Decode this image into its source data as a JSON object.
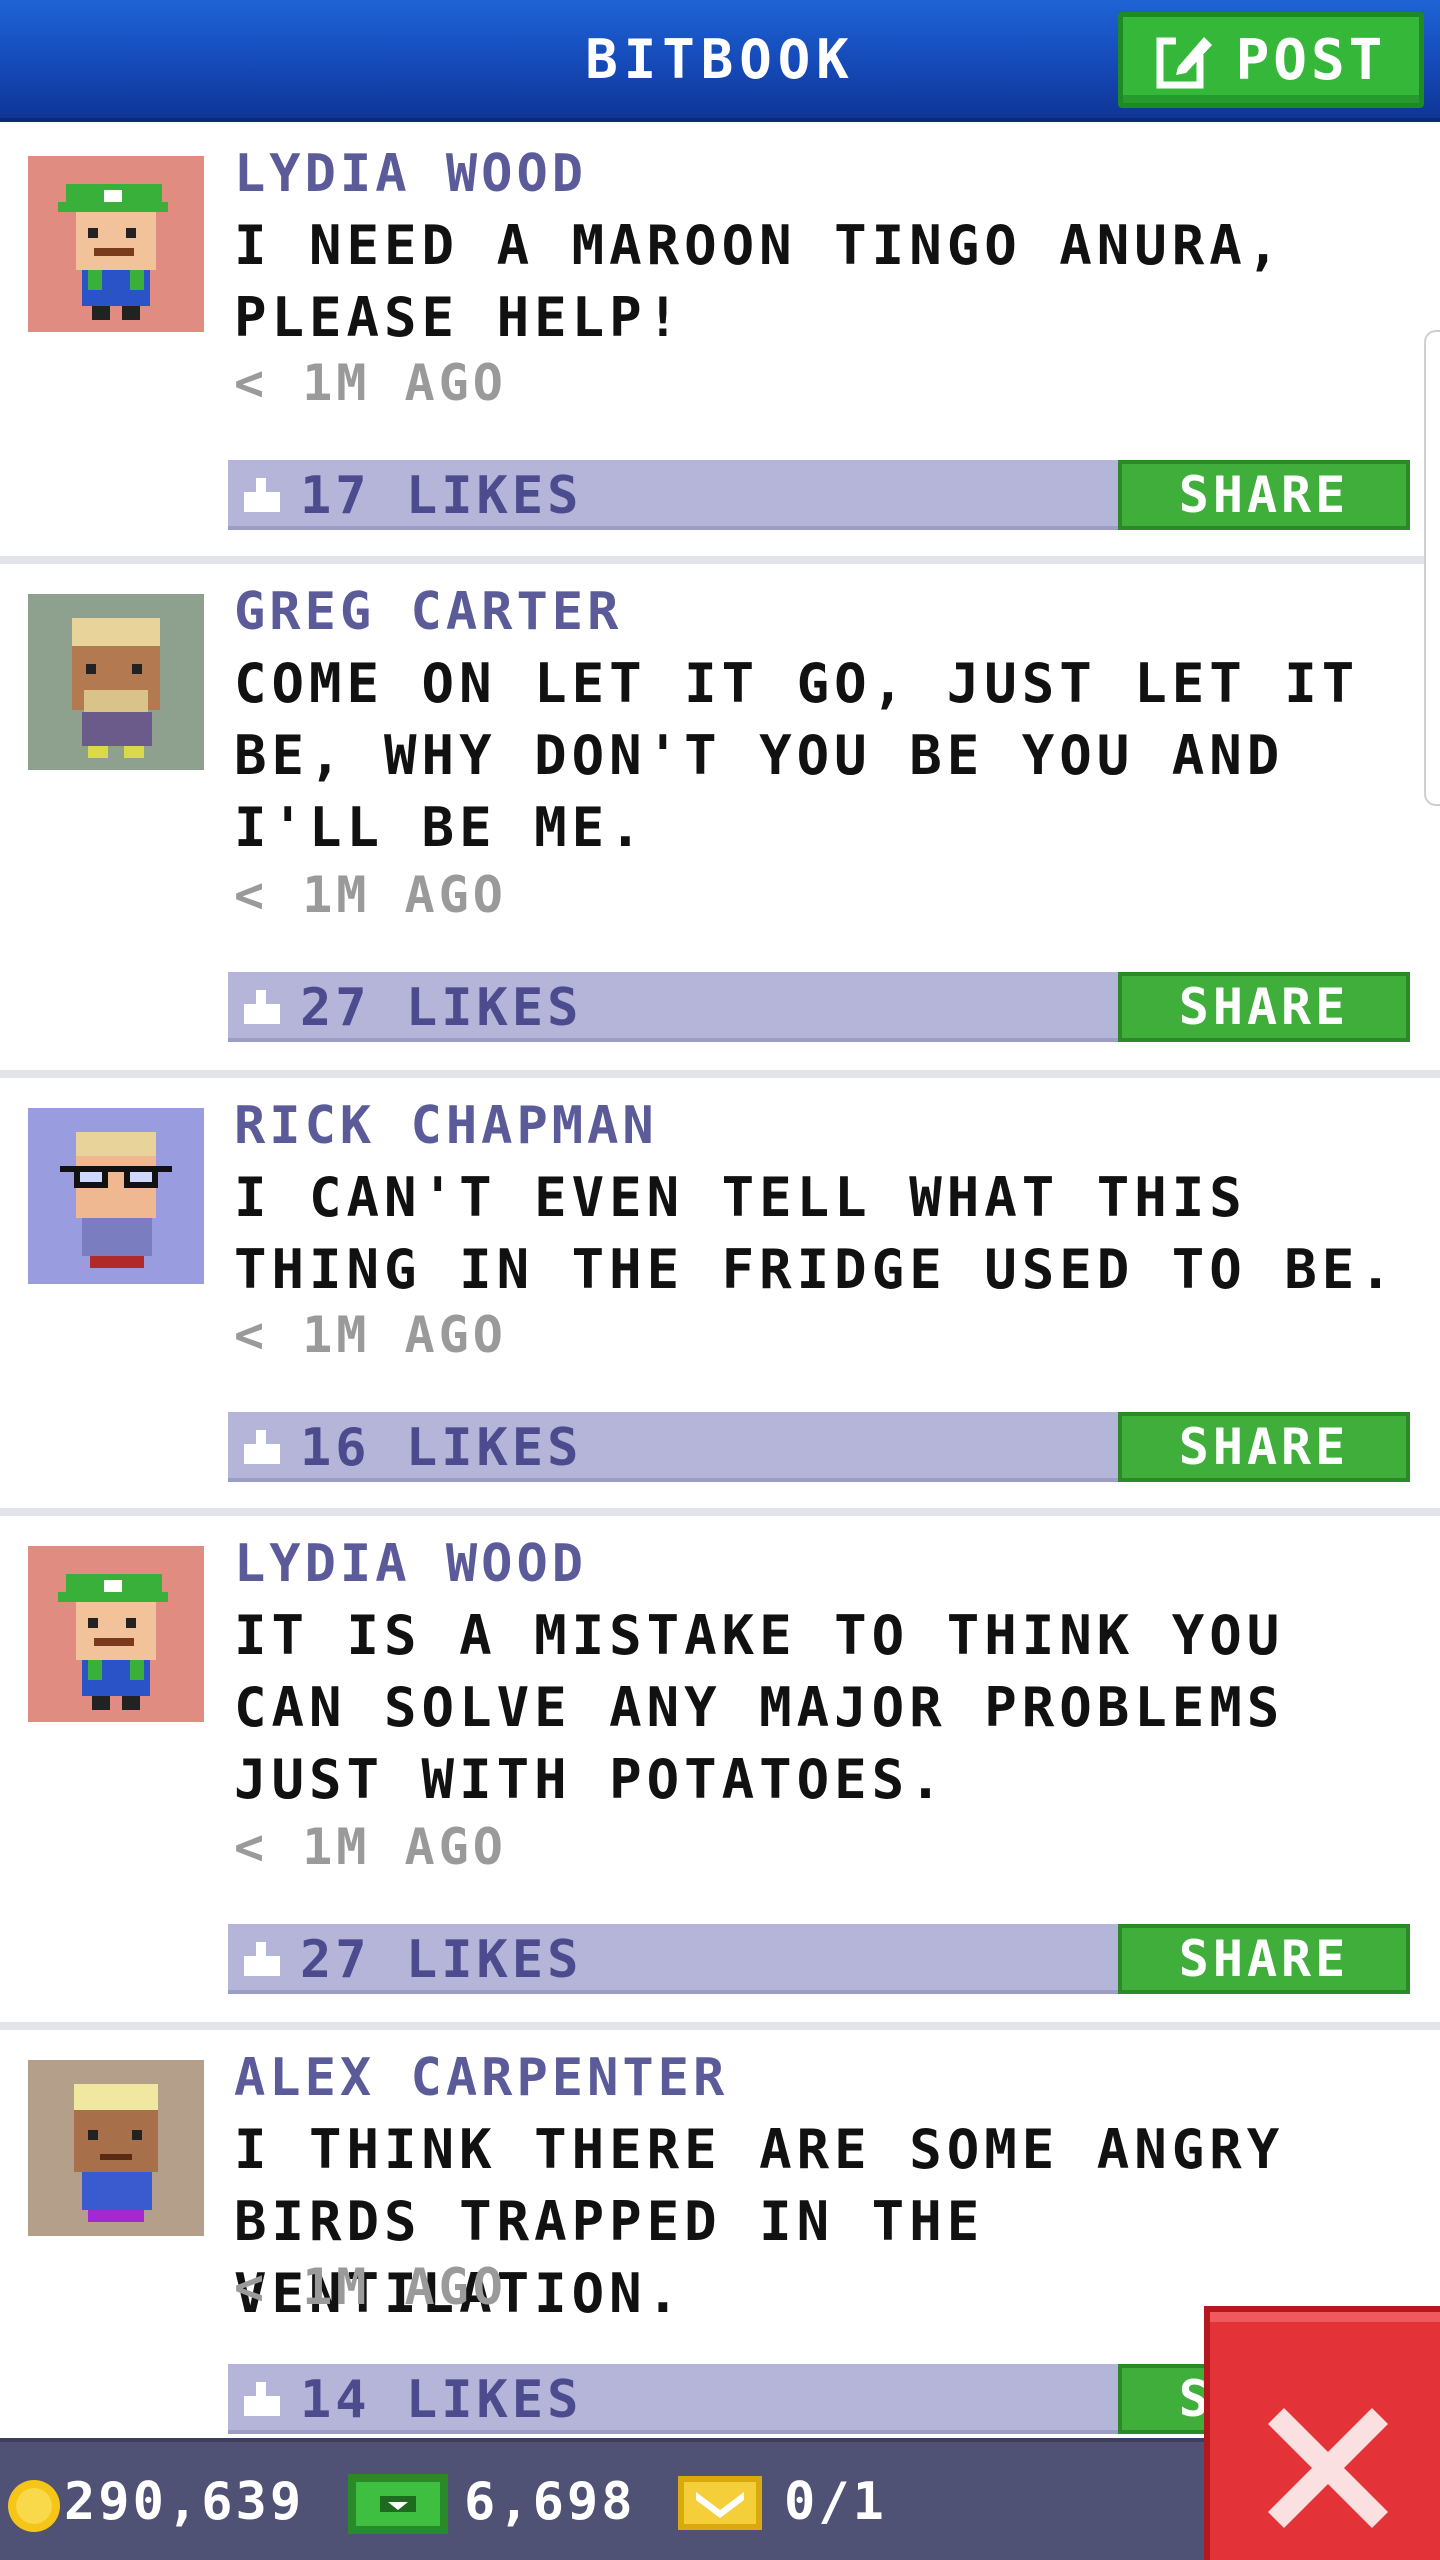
{
  "header": {
    "title": "BITBOOK",
    "post_label": "POST",
    "post_icon": "edit-icon"
  },
  "posts": [
    {
      "author": "LYDIA WOOD",
      "message": "I NEED A MAROON TINGO ANURA, PLEASE HELP!",
      "time": "< 1M AGO",
      "likes": "17 LIKES",
      "share_label": "SHARE",
      "avatar_color": "#e08c80"
    },
    {
      "author": "GREG CARTER",
      "message": "COME ON LET IT GO, JUST LET IT BE, WHY DON'T YOU BE YOU AND I'LL BE ME.",
      "time": "< 1M AGO",
      "likes": "27 LIKES",
      "share_label": "SHARE",
      "avatar_color": "#8ea08e"
    },
    {
      "author": "RICK CHAPMAN",
      "message": "I CAN'T EVEN TELL WHAT THIS THING IN THE FRIDGE USED TO BE.",
      "time": "< 1M AGO",
      "likes": "16 LIKES",
      "share_label": "SHARE",
      "avatar_color": "#9a9ce0"
    },
    {
      "author": "LYDIA WOOD",
      "message": "IT IS A MISTAKE TO THINK YOU CAN SOLVE ANY MAJOR PROBLEMS JUST WITH POTATOES.",
      "time": "< 1M AGO",
      "likes": "27 LIKES",
      "share_label": "SHARE",
      "avatar_color": "#e08c80"
    },
    {
      "author": "ALEX CARPENTER",
      "message": "I THINK THERE ARE SOME ANGRY BIRDS TRAPPED IN THE VENTILATION.",
      "time": "< 1M AGO",
      "likes": "14 LIKES",
      "share_label": "SHARE",
      "avatar_color": "#b4a08a"
    }
  ],
  "status": {
    "coins": "290,639",
    "cash": "6,698",
    "tickets": "0/1"
  },
  "colors": {
    "header_blue": "#1447b4",
    "accent_green": "#3fae3a",
    "likes_bar": "#b4b5d8",
    "author_purple": "#5c5b99",
    "close_red": "#e33238"
  }
}
